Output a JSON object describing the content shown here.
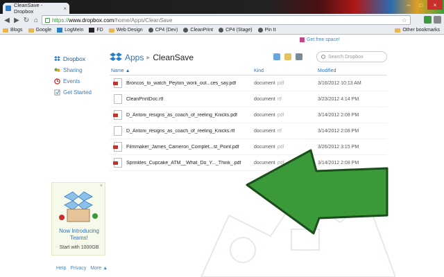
{
  "browser": {
    "tab_title": "CleanSave - Dropbox",
    "tab_close": "×",
    "window_buttons": [
      "–",
      "□",
      "×"
    ],
    "nav": {
      "back": "◀",
      "forward": "▶",
      "reload": "↻",
      "home": "⌂"
    },
    "url_scheme": "https://",
    "url_host": "www.dropbox.com",
    "url_path": "/home/Apps/CleanSave",
    "bookmarks": [
      {
        "label": "Blogs",
        "icon": "folder-icon"
      },
      {
        "label": "Google",
        "icon": "folder-icon"
      },
      {
        "label": "LogMeIn",
        "icon": "logmein-icon"
      },
      {
        "label": "FD",
        "icon": "fd-icon"
      },
      {
        "label": "Web Design",
        "icon": "folder-icon"
      },
      {
        "label": "CP4 (Dev)",
        "icon": "globe-icon"
      },
      {
        "label": "CleanPrint",
        "icon": "globe-icon"
      },
      {
        "label": "CP4 (Stage)",
        "icon": "globe-icon"
      },
      {
        "label": "Pin It",
        "icon": "globe-icon"
      }
    ],
    "other_bookmarks": "Other bookmarks"
  },
  "sidebar": {
    "items": [
      {
        "label": "Dropbox",
        "icon": "dropbox-icon"
      },
      {
        "label": "Sharing",
        "icon": "sharing-icon"
      },
      {
        "label": "Events",
        "icon": "events-icon"
      },
      {
        "label": "Get Started",
        "icon": "get-started-icon"
      }
    ]
  },
  "promo": {
    "close": "×",
    "title": "Now Introducing Teams!",
    "subtitle": "Start with 1000GB"
  },
  "footer": {
    "links": [
      "Help",
      "Privacy",
      "More ▲"
    ]
  },
  "header": {
    "get_free_space": "Get free space!",
    "crumb_root": "Apps",
    "crumb_sep": "▸",
    "crumb_current": "CleanSave",
    "search_placeholder": "Search Dropbox"
  },
  "table": {
    "columns": {
      "name": "Name ▲",
      "kind": "Kind",
      "modified": "Modified"
    },
    "rows": [
      {
        "name": "Broncos_to_watch_Peyton_work_out...ces_say.pdf",
        "kind": "document",
        "ext": "pdf",
        "modified": "3/16/2012 10:13 AM",
        "type": "pdf"
      },
      {
        "name": "CleanPrintDoc.rtf",
        "kind": "document",
        "ext": "rtf",
        "modified": "3/23/2012 4:14 PM",
        "type": "rtf"
      },
      {
        "name": "D_Antoni_resigns_as_coach_of_reeling_Knicks.pdf",
        "kind": "document",
        "ext": "pdf",
        "modified": "3/14/2012 2:08 PM",
        "type": "pdf"
      },
      {
        "name": "D_Antoni_resigns_as_coach_of_reeling_Knicks.rtf",
        "kind": "document",
        "ext": "rtf",
        "modified": "3/14/2012 2:08 PM",
        "type": "rtf"
      },
      {
        "name": "Filmmaker_James_Cameron_Complet...st_Point.pdf",
        "kind": "document",
        "ext": "pdf",
        "modified": "3/26/2012 3:15 PM",
        "type": "pdf"
      },
      {
        "name": "Sprinkles_Cupcake_ATM__What_Do_Y..._Think_.pdf",
        "kind": "document",
        "ext": "pdf",
        "modified": "3/14/2012 2:08 PM",
        "type": "pdf"
      }
    ]
  },
  "colors": {
    "arrow_fill": "#3a9a3a",
    "arrow_stroke": "#1c4d1c",
    "link": "#2a75c0"
  }
}
